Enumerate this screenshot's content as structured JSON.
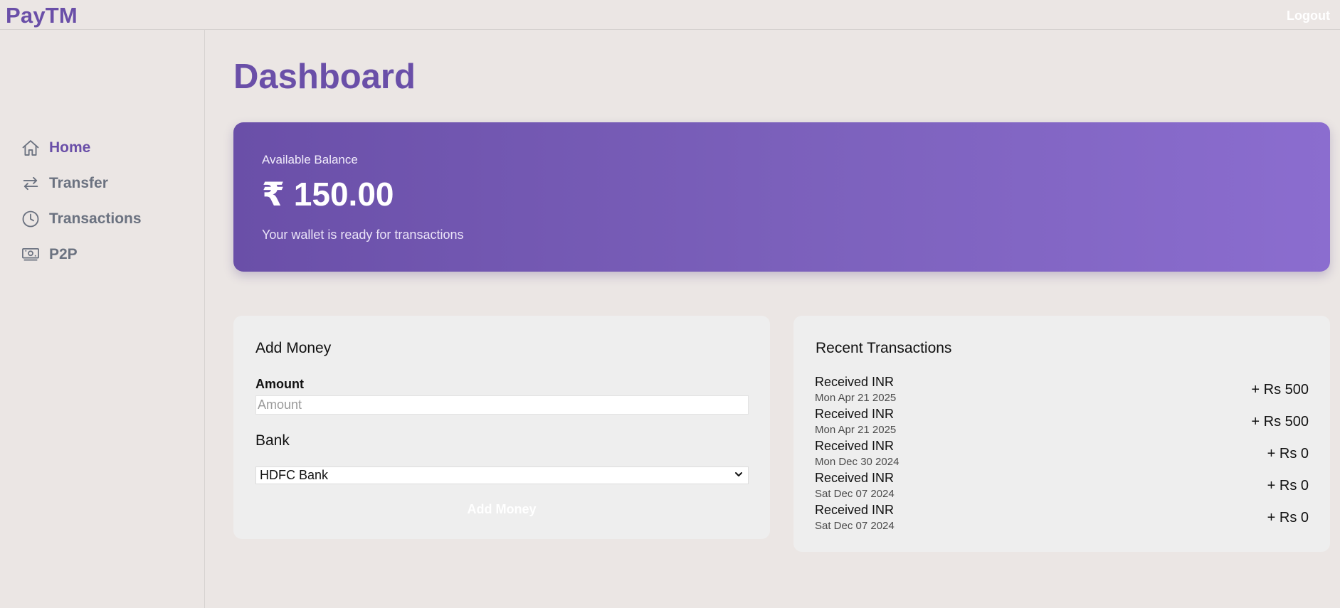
{
  "header": {
    "brand": "PayTM",
    "logout_label": "Logout"
  },
  "sidebar": {
    "items": [
      {
        "label": "Home",
        "icon": "home-icon",
        "active": true
      },
      {
        "label": "Transfer",
        "icon": "arrows-transfer-icon",
        "active": false
      },
      {
        "label": "Transactions",
        "icon": "clock-icon",
        "active": false
      },
      {
        "label": "P2P",
        "icon": "banknote-icon",
        "active": false
      }
    ]
  },
  "main": {
    "title": "Dashboard",
    "balance": {
      "label": "Available Balance",
      "amount": "₹ 150.00",
      "note": "Your wallet is ready for transactions"
    },
    "add_money": {
      "title": "Add Money",
      "amount_label": "Amount",
      "amount_value": "",
      "amount_placeholder": "Amount",
      "bank_label": "Bank",
      "bank_selected": "HDFC Bank",
      "button_label": "Add Money"
    },
    "recent_transactions": {
      "title": "Recent Transactions",
      "items": [
        {
          "title": "Received INR",
          "date": "Mon Apr 21 2025",
          "amount": "+ Rs 500"
        },
        {
          "title": "Received INR",
          "date": "Mon Apr 21 2025",
          "amount": "+ Rs 500"
        },
        {
          "title": "Received INR",
          "date": "Mon Dec 30 2024",
          "amount": "+ Rs 0"
        },
        {
          "title": "Received INR",
          "date": "Sat Dec 07 2024",
          "amount": "+ Rs 0"
        },
        {
          "title": "Received INR",
          "date": "Sat Dec 07 2024",
          "amount": "+ Rs 0"
        }
      ]
    }
  },
  "colors": {
    "brand": "#6a4fa8",
    "background": "#ebe6e4",
    "card": "#eeeeee",
    "muted_nav": "#6b7280"
  }
}
